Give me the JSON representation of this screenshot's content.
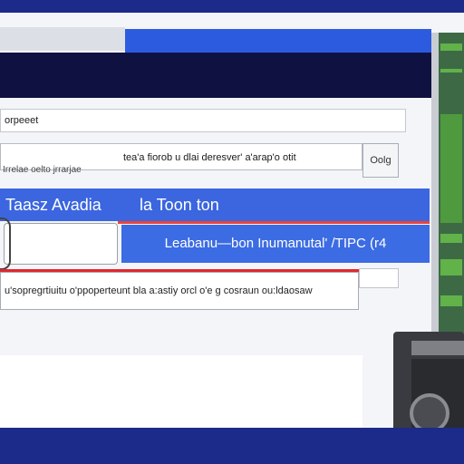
{
  "window": {
    "title": ""
  },
  "address_bar": {
    "value": "orpeeet"
  },
  "row2": {
    "text": "tea'a fiorob u dlai deresver' a'arap'o otit",
    "sub_text": "Irrelae oelto jrrarjae",
    "button_label": "Oolg"
  },
  "blue_header": {
    "left_label": "Taasz Avadia",
    "right_label": "la Toon ton"
  },
  "action_button": {
    "label": "Leabanu—bon Inumanutal' /TIPC (r4"
  },
  "row4": {
    "text": "u'sopregrtiuitu o'ppoperteunt bla a:astiy orcl o'e g cosraun ou:ldaosaw"
  },
  "colors": {
    "frame": "#1c2a8a",
    "titlebar": "#0f1240",
    "accent_blue": "#3b66df",
    "accent_red": "#e2262e",
    "side_panel_green": "#62b24a"
  }
}
